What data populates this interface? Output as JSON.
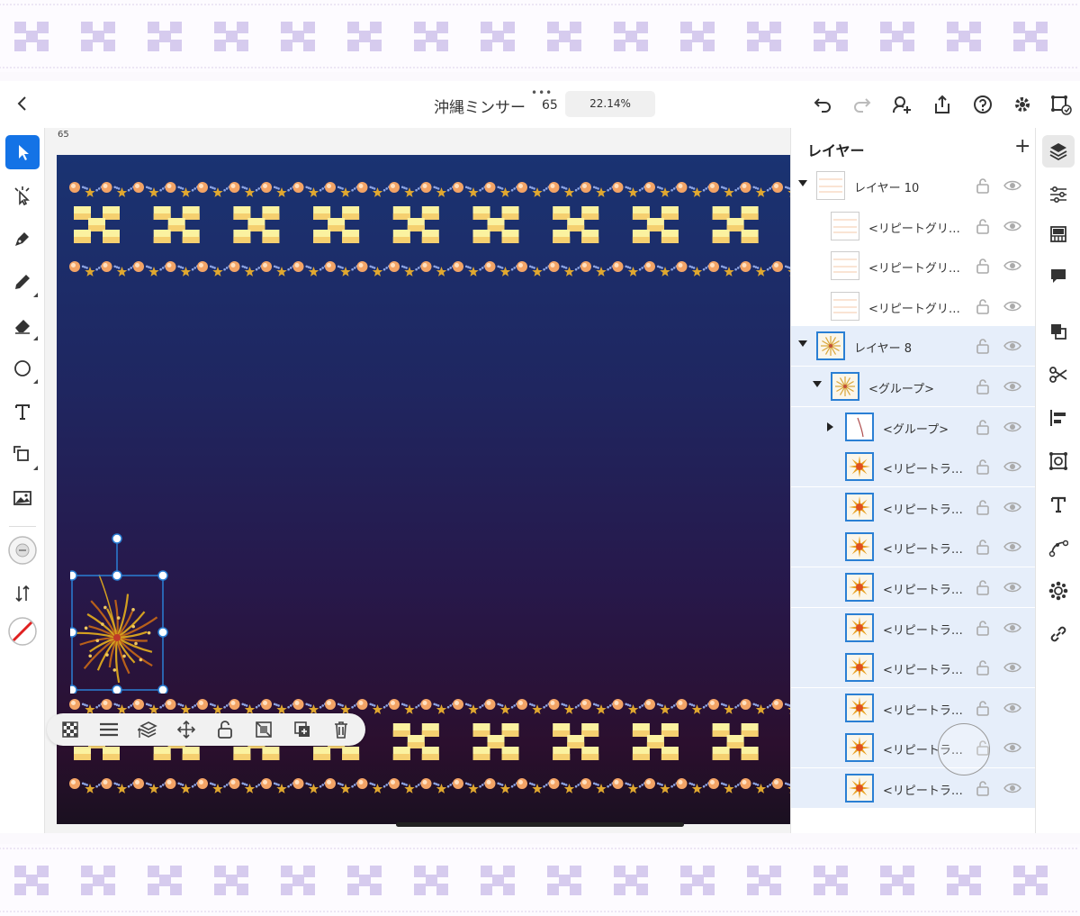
{
  "topbar": {
    "title": "沖縄ミンサー",
    "doc_number": "65",
    "zoom": "22.14%"
  },
  "canvas": {
    "ruler_label": "65"
  },
  "colors": {
    "accent": "#1473e6",
    "selection": "#2a7fd4",
    "layer_selected_bg": "#e6eefa"
  },
  "layers_panel": {
    "title": "レイヤー",
    "add_label": "+",
    "rows": [
      {
        "name": "レイヤー 10",
        "indent": 0,
        "arrow": "down",
        "thumb": "stripe",
        "selected": false
      },
      {
        "name": "<リピートグリ…",
        "indent": 1,
        "arrow": "",
        "thumb": "stripe",
        "selected": false
      },
      {
        "name": "<リピートグリ…",
        "indent": 1,
        "arrow": "",
        "thumb": "stripe",
        "selected": false
      },
      {
        "name": "<リピートグリ…",
        "indent": 1,
        "arrow": "",
        "thumb": "stripe",
        "selected": false
      },
      {
        "name": "レイヤー 8",
        "indent": 0,
        "arrow": "down",
        "thumb": "firework",
        "selected": true
      },
      {
        "name": "<グループ>",
        "indent": 1,
        "arrow": "down",
        "thumb": "firework",
        "selected": true
      },
      {
        "name": "<グループ>",
        "indent": 2,
        "arrow": "right",
        "thumb": "line",
        "selected": true
      },
      {
        "name": "<リピートラ…",
        "indent": 2,
        "arrow": "",
        "thumb": "burst",
        "selected": true
      },
      {
        "name": "<リピートラ…",
        "indent": 2,
        "arrow": "",
        "thumb": "burst",
        "selected": true
      },
      {
        "name": "<リピートラ…",
        "indent": 2,
        "arrow": "",
        "thumb": "burst",
        "selected": true
      },
      {
        "name": "<リピートラ…",
        "indent": 2,
        "arrow": "",
        "thumb": "burst",
        "selected": true
      },
      {
        "name": "<リピートラ…",
        "indent": 2,
        "arrow": "",
        "thumb": "burst",
        "selected": true
      },
      {
        "name": "<リピートラ…",
        "indent": 2,
        "arrow": "",
        "thumb": "burst",
        "selected": true
      },
      {
        "name": "<リピートラ…",
        "indent": 2,
        "arrow": "",
        "thumb": "burst",
        "selected": true
      },
      {
        "name": "<リピートラ…",
        "indent": 2,
        "arrow": "",
        "thumb": "burst",
        "selected": true
      },
      {
        "name": "<リピートラ…",
        "indent": 2,
        "arrow": "",
        "thumb": "burst",
        "selected": true
      }
    ]
  }
}
